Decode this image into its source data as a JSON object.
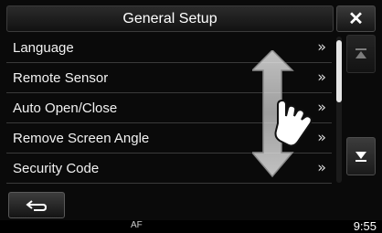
{
  "header": {
    "title": "General Setup",
    "close_label": "✕"
  },
  "list": {
    "items": [
      {
        "label": "Language",
        "arrow": "»"
      },
      {
        "label": "Remote Sensor",
        "arrow": "»"
      },
      {
        "label": "Auto Open/Close",
        "arrow": "»"
      },
      {
        "label": "Remove Screen Angle",
        "arrow": "»"
      },
      {
        "label": "Security Code",
        "arrow": "»"
      }
    ]
  },
  "scroll": {
    "position_fraction": 0.0
  },
  "status": {
    "af": "AF",
    "time": "9:55"
  },
  "icons": {
    "close": "close-icon",
    "scroll_up": "scroll-top-icon",
    "scroll_down": "scroll-bottom-icon",
    "back": "back-arrow-icon",
    "gesture": "swipe-hand-icon"
  }
}
